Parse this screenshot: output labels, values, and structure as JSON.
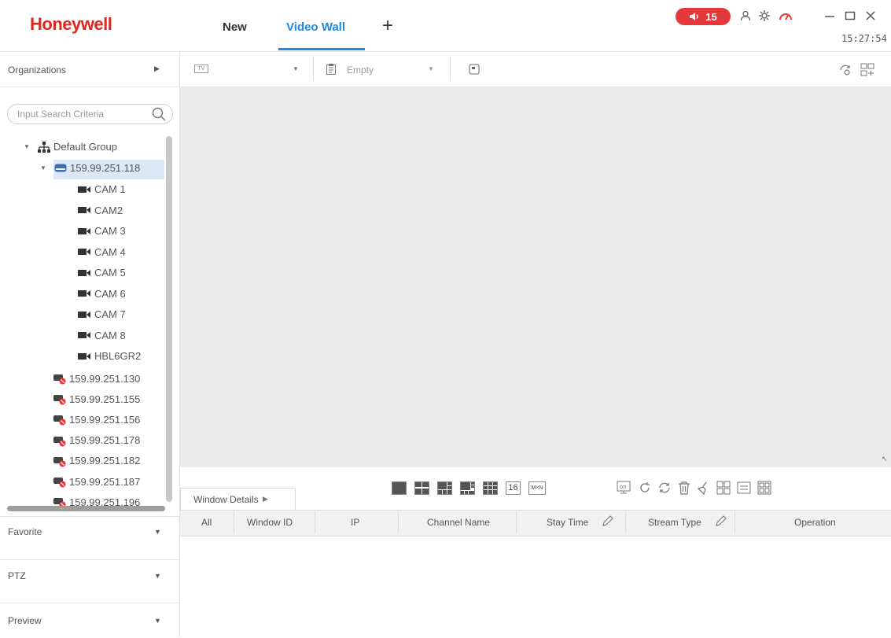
{
  "header": {
    "logo": "Honeywell",
    "tabs": [
      {
        "label": "New"
      },
      {
        "label": "Video Wall"
      }
    ],
    "add_tab": "+",
    "alarm_count": "15",
    "clock": "15:27:54"
  },
  "sidebar": {
    "organizations_label": "Organizations",
    "search_placeholder": "Input Search Criteria",
    "tree": {
      "group": "Default Group",
      "selected_device": "159.99.251.118",
      "cameras": [
        "CAM 1",
        "CAM2",
        "CAM 3",
        "CAM 4",
        "CAM 5",
        "CAM 6",
        "CAM 7",
        "CAM 8",
        "HBL6GR2"
      ],
      "offline_devices": [
        "159.99.251.130",
        "159.99.251.155",
        "159.99.251.156",
        "159.99.251.178",
        "159.99.251.182",
        "159.99.251.187",
        "159.99.251.196"
      ]
    },
    "panels": [
      "Favorite",
      "PTZ",
      "Preview"
    ]
  },
  "toolbar": {
    "wall_select": "TV",
    "scene_select": "Empty"
  },
  "bottom": {
    "window_details_label": "Window Details",
    "layout_16_label": "16",
    "layout_mxn_label": "M×N",
    "columns": [
      "All",
      "Window ID",
      "IP",
      "Channel Name",
      "Stay Time",
      "Stream Type",
      "Operation"
    ]
  },
  "colors": {
    "brand": "#e1261c",
    "accent": "#1e88e5",
    "alarm": "#e5383b",
    "selected_bg": "#dbe9f7",
    "video_bg": "#ebebeb"
  }
}
